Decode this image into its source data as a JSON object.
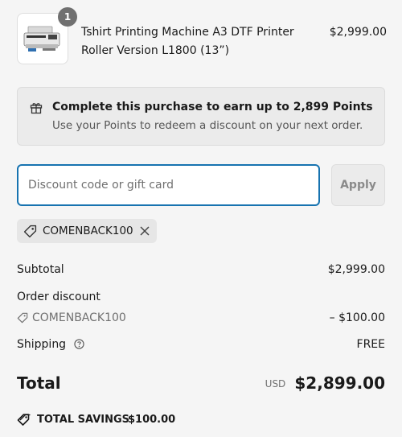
{
  "line_item": {
    "quantity": "1",
    "title": "Tshirt Printing Machine A3 DTF Printer Roller Version L1800 (13”)",
    "price": "$2,999.00",
    "thumbnail_icon": "printer-image"
  },
  "points_banner": {
    "icon": "gift-icon",
    "title": "Complete this purchase to earn up to 2,899 Points",
    "subtitle": "Use your Points to redeem a discount on your next order."
  },
  "discount": {
    "placeholder": "Discount code or gift card",
    "value": "",
    "apply_label": "Apply",
    "applied_code": "COMENBACK100"
  },
  "summary": {
    "subtotal_label": "Subtotal",
    "subtotal_value": "$2,999.00",
    "order_discount_label": "Order discount",
    "discount_code": "COMENBACK100",
    "discount_value": "– $100.00",
    "shipping_label": "Shipping",
    "shipping_value": "FREE",
    "total_label": "Total",
    "currency": "USD",
    "total_value": "$2,899.00",
    "savings_label": "TOTAL SAVINGS",
    "savings_value": "$100.00"
  },
  "colors": {
    "focus_border": "#1773b0",
    "background": "#f5f5f5",
    "muted_text": "#707070"
  }
}
